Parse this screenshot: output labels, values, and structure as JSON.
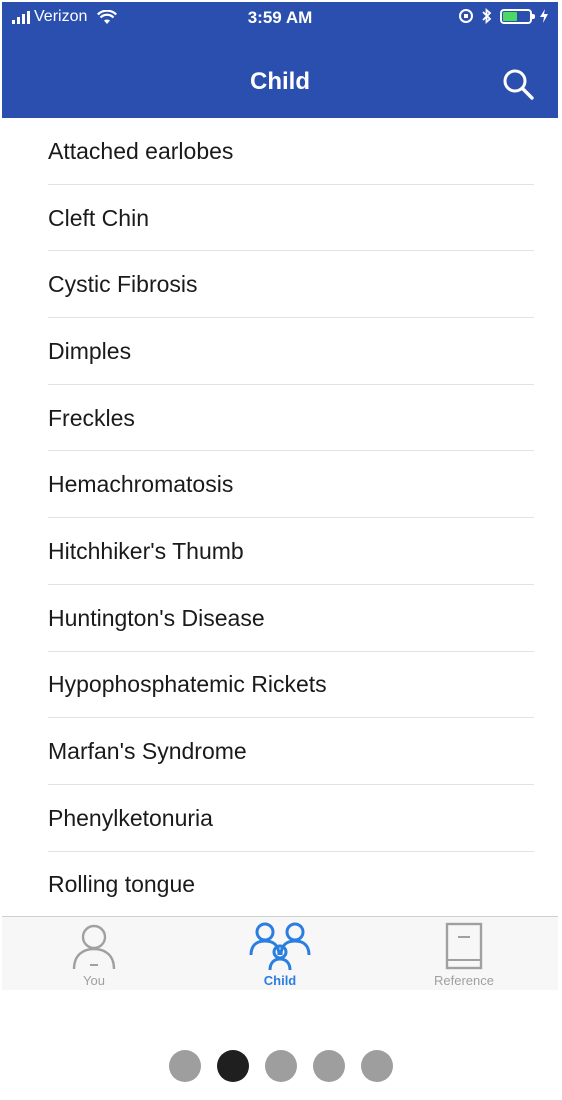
{
  "status_bar": {
    "carrier": "Verizon",
    "time": "3:59 AM"
  },
  "nav": {
    "title": "Child"
  },
  "list": {
    "items": [
      "Attached earlobes",
      "Cleft Chin",
      "Cystic Fibrosis",
      "Dimples",
      "Freckles",
      "Hemachromatosis",
      "Hitchhiker's Thumb",
      "Huntington's Disease",
      "Hypophosphatemic Rickets",
      "Marfan's Syndrome",
      "Phenylketonuria",
      "Rolling tongue"
    ]
  },
  "tabbar": {
    "tabs": [
      {
        "label": "You",
        "icon": "person-icon",
        "active": false
      },
      {
        "label": "Child",
        "icon": "family-icon",
        "active": true
      },
      {
        "label": "Reference",
        "icon": "book-icon",
        "active": false
      }
    ]
  },
  "pager": {
    "total": 5,
    "current": 2
  },
  "colors": {
    "header": "#2a4fae",
    "active_tab": "#2a7ee0",
    "inactive_tab": "#a0a0a0"
  }
}
